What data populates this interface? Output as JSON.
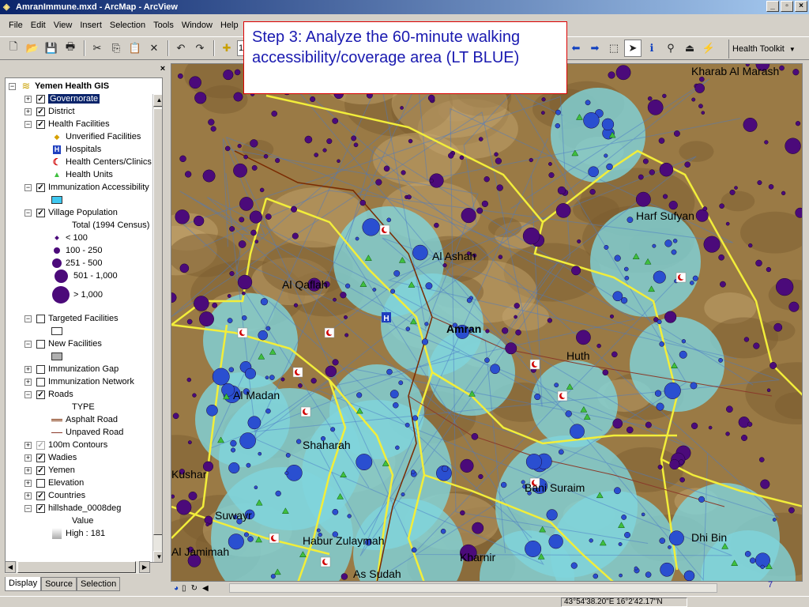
{
  "window": {
    "title": "AmranImmune.mxd - ArcMap - ArcView"
  },
  "menu": [
    "File",
    "Edit",
    "View",
    "Insert",
    "Selection",
    "Tools",
    "Window",
    "Help"
  ],
  "toolbar": {
    "scale_value": "1",
    "health_toolkit_label": "Health Toolkit"
  },
  "callout": {
    "text": "Step 3: Analyze the 60-minute walking accessibility/coverage area (LT BLUE)"
  },
  "toc": {
    "root": "Yemen Health GIS",
    "items": [
      {
        "label": "Governorate",
        "expander": "+",
        "check": "✓"
      },
      {
        "label": "District",
        "expander": "+",
        "check": "✓"
      },
      {
        "label": "Health Facilities",
        "expander": "−",
        "check": "✓"
      },
      {
        "label": "Unverified Facilities"
      },
      {
        "label": "Hospitals"
      },
      {
        "label": "Health Centers/Clinics"
      },
      {
        "label": "Health Units"
      },
      {
        "label": "Immunization Accessibility",
        "expander": "−",
        "check": "✓"
      },
      {
        "label": "Village Population",
        "expander": "−",
        "check": "✓"
      },
      {
        "label": "Total (1994 Census)"
      },
      {
        "label": "< 100"
      },
      {
        "label": "100 - 250"
      },
      {
        "label": "251 - 500"
      },
      {
        "label": "501 - 1,000"
      },
      {
        "label": "> 1,000"
      },
      {
        "label": "Targeted Facilities",
        "expander": "−",
        "check": ""
      },
      {
        "label": "New Facilities",
        "expander": "−",
        "check": ""
      },
      {
        "label": "Immunization Gap",
        "expander": "+",
        "check": ""
      },
      {
        "label": "Immunization Network",
        "expander": "+",
        "check": ""
      },
      {
        "label": "Roads",
        "expander": "−",
        "check": "✓"
      },
      {
        "label": "TYPE"
      },
      {
        "label": "Asphalt Road"
      },
      {
        "label": "Unpaved Road"
      },
      {
        "label": "100m Contours",
        "expander": "+",
        "check": "✓"
      },
      {
        "label": "Wadies",
        "expander": "+",
        "check": "✓"
      },
      {
        "label": "Yemen",
        "expander": "+",
        "check": "✓"
      },
      {
        "label": "Elevation",
        "expander": "+",
        "check": ""
      },
      {
        "label": "Countries",
        "expander": "+",
        "check": "✓"
      },
      {
        "label": "hillshade_0008deg",
        "expander": "−",
        "check": "✓"
      },
      {
        "label": "Value"
      },
      {
        "label": "High : 181"
      }
    ],
    "tabs": [
      "Display",
      "Source",
      "Selection"
    ]
  },
  "map": {
    "labels": [
      "Kharab Al Marash",
      "Harf Sufyan",
      "Al Ashah",
      "Al Qaflah",
      "Amran",
      "Huth",
      "Al Madan",
      "Shaharah",
      "Kushar",
      "Bani Suraim",
      "Suwayr",
      "Dhi Bin",
      "Al Jamimah",
      "Habur Zulaymah",
      "Kharnir",
      "As Sudah"
    ],
    "colors": {
      "terrain": "#9a7a45",
      "coverage": "#7fd4dc",
      "district_border": "#f2ee3a",
      "village": "#4b0a7a",
      "covered_village": "#2a4fd0",
      "health_unit": "#3fbf3f"
    }
  },
  "page_number": "7",
  "status": {
    "coords": "43°54'38.20\"E  16°2'42.17\"N"
  }
}
